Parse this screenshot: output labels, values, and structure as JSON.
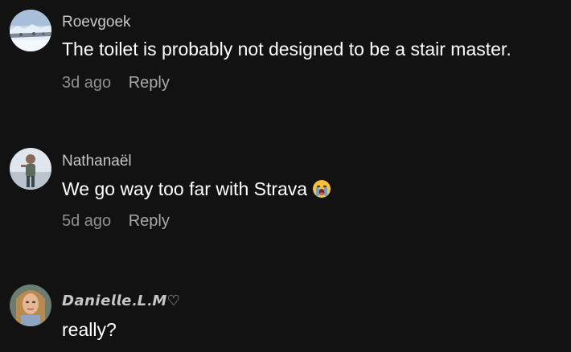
{
  "comments": [
    {
      "username": "Roevgoek",
      "text": "The toilet is probably not designed to be a stair master.",
      "time": "3d ago",
      "reply_label": "Reply",
      "avatar_icon": "snowy-landscape-avatar"
    },
    {
      "username": "Nathanaël",
      "text": "We go way too far with Strava",
      "emoji": "loudly-crying-face-emoji",
      "time": "5d ago",
      "reply_label": "Reply",
      "avatar_icon": "person-photo-avatar"
    },
    {
      "username": "𝘿𝙖𝙣𝙞𝙚𝙡𝙡𝙚.𝙇.𝙈♡",
      "text": "really?",
      "avatar_icon": "woman-selfie-avatar"
    }
  ],
  "colors": {
    "background": "#121212",
    "username": "#c7c7c7",
    "text": "#ffffff",
    "meta": "#8f8f8f"
  }
}
